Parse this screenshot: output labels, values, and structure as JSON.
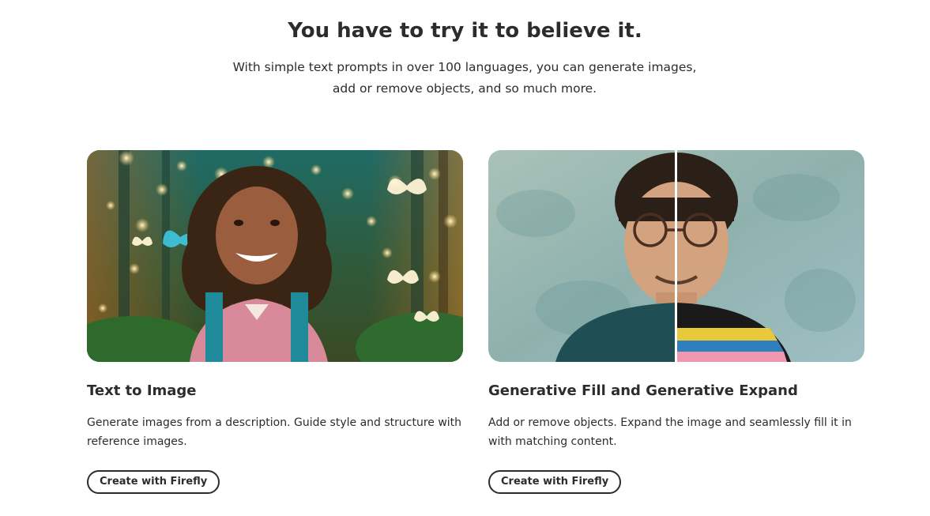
{
  "hero": {
    "title": "You have to try it to believe it.",
    "subtitle_line1": "With simple text prompts in over 100 languages, you can generate images,",
    "subtitle_line2": "add or remove objects, and so much more."
  },
  "cards": [
    {
      "title": "Text to Image",
      "description": "Generate images from a description. Guide style and structure with reference images.",
      "button_label": "Create with Firefly"
    },
    {
      "title": "Generative Fill and Generative Expand",
      "description": "Add or remove objects. Expand the image and seamlessly fill it in with matching content.",
      "button_label": "Create with Firefly"
    }
  ],
  "colors": {
    "text": "#2c2c2c",
    "background": "#ffffff"
  }
}
